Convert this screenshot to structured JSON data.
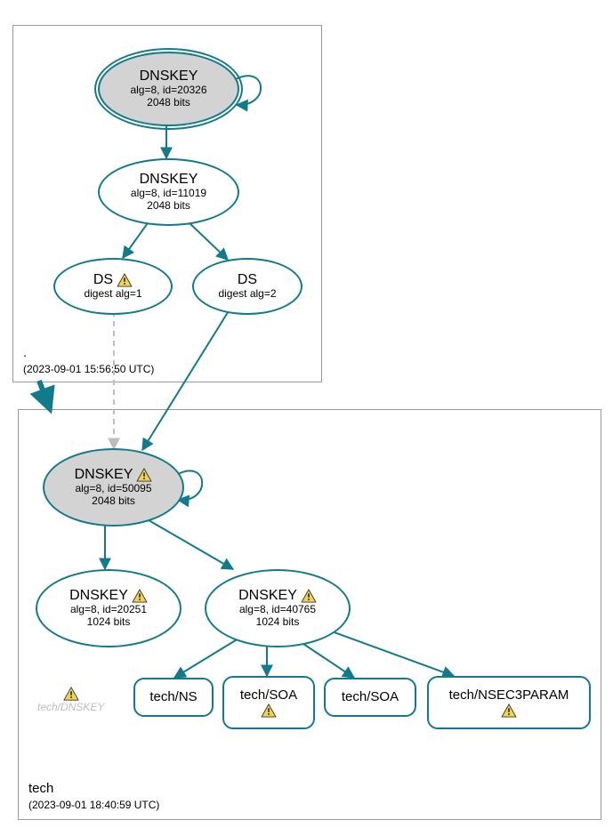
{
  "zones": {
    "root": {
      "name": ".",
      "timestamp": "(2023-09-01 15:56:50 UTC)"
    },
    "tech": {
      "name": "tech",
      "timestamp": "(2023-09-01 18:40:59 UTC)"
    }
  },
  "nodes": {
    "root_ksk": {
      "title": "DNSKEY",
      "sub1": "alg=8, id=20326",
      "sub2": "2048 bits"
    },
    "root_zsk": {
      "title": "DNSKEY",
      "sub1": "alg=8, id=11019",
      "sub2": "2048 bits"
    },
    "ds1": {
      "title": "DS",
      "sub1": "digest alg=1"
    },
    "ds2": {
      "title": "DS",
      "sub1": "digest alg=2"
    },
    "tech_ksk": {
      "title": "DNSKEY",
      "sub1": "alg=8, id=50095",
      "sub2": "2048 bits"
    },
    "tech_zsk1": {
      "title": "DNSKEY",
      "sub1": "alg=8, id=20251",
      "sub2": "1024 bits"
    },
    "tech_zsk2": {
      "title": "DNSKEY",
      "sub1": "alg=8, id=40765",
      "sub2": "1024 bits"
    },
    "rr_ns": {
      "title": "tech/NS"
    },
    "rr_soa_w": {
      "title": "tech/SOA"
    },
    "rr_soa": {
      "title": "tech/SOA"
    },
    "rr_nsec3": {
      "title": "tech/NSEC3PARAM"
    }
  },
  "floating": {
    "tech_dnskey": "tech/DNSKEY"
  },
  "colors": {
    "stroke": "#117a8b",
    "fill_grey": "#d3d3d3",
    "dashed": "#bdbdbd",
    "warn_fill": "#f4d24a",
    "warn_stroke": "#333"
  },
  "chart_data": {
    "type": "graph",
    "description": "DNSSEC authentication chain / DNSViz-style delegation graph from the root zone (.) to the 'tech' TLD, showing DNSKEY, DS, and signed RRsets with warning annotations.",
    "zones": [
      {
        "id": "root",
        "label": ".",
        "timestamp": "2023-09-01 15:56:50 UTC"
      },
      {
        "id": "tech",
        "label": "tech",
        "timestamp": "2023-09-01 18:40:59 UTC"
      }
    ],
    "nodes": [
      {
        "id": "root_ksk",
        "zone": "root",
        "type": "DNSKEY",
        "algorithm": 8,
        "key_id": 20326,
        "key_bits": 2048,
        "ksk": true,
        "trust_anchor": true,
        "warning": false
      },
      {
        "id": "root_zsk",
        "zone": "root",
        "type": "DNSKEY",
        "algorithm": 8,
        "key_id": 11019,
        "key_bits": 2048,
        "ksk": false,
        "warning": false
      },
      {
        "id": "ds1",
        "zone": "root",
        "type": "DS",
        "digest_algorithm": 1,
        "warning": true
      },
      {
        "id": "ds2",
        "zone": "root",
        "type": "DS",
        "digest_algorithm": 2,
        "warning": false
      },
      {
        "id": "tech_ksk",
        "zone": "tech",
        "type": "DNSKEY",
        "algorithm": 8,
        "key_id": 50095,
        "key_bits": 2048,
        "ksk": true,
        "warning": true
      },
      {
        "id": "tech_zsk1",
        "zone": "tech",
        "type": "DNSKEY",
        "algorithm": 8,
        "key_id": 20251,
        "key_bits": 1024,
        "ksk": false,
        "warning": true
      },
      {
        "id": "tech_zsk2",
        "zone": "tech",
        "type": "DNSKEY",
        "algorithm": 8,
        "key_id": 40765,
        "key_bits": 1024,
        "ksk": false,
        "warning": true
      },
      {
        "id": "rr_ns",
        "zone": "tech",
        "type": "RRset",
        "name": "tech/NS",
        "warning": false
      },
      {
        "id": "rr_soa_w",
        "zone": "tech",
        "type": "RRset",
        "name": "tech/SOA",
        "warning": true
      },
      {
        "id": "rr_soa",
        "zone": "tech",
        "type": "RRset",
        "name": "tech/SOA",
        "warning": false
      },
      {
        "id": "rr_nsec3",
        "zone": "tech",
        "type": "RRset",
        "name": "tech/NSEC3PARAM",
        "warning": true
      },
      {
        "id": "tech_dnskey_warn",
        "zone": "tech",
        "type": "annotation",
        "name": "tech/DNSKEY",
        "warning": true
      }
    ],
    "edges": [
      {
        "from": "root_ksk",
        "to": "root_ksk",
        "kind": "self-sign",
        "style": "solid"
      },
      {
        "from": "root_ksk",
        "to": "root_zsk",
        "kind": "signs",
        "style": "solid"
      },
      {
        "from": "root_zsk",
        "to": "ds1",
        "kind": "signs",
        "style": "solid"
      },
      {
        "from": "root_zsk",
        "to": "ds2",
        "kind": "signs",
        "style": "solid"
      },
      {
        "from": "ds1",
        "to": "tech_ksk",
        "kind": "delegation",
        "style": "dashed"
      },
      {
        "from": "ds2",
        "to": "tech_ksk",
        "kind": "delegation",
        "style": "solid"
      },
      {
        "from": "root",
        "to": "tech",
        "kind": "zone-delegation",
        "style": "solid-thick"
      },
      {
        "from": "tech_ksk",
        "to": "tech_ksk",
        "kind": "self-sign",
        "style": "solid"
      },
      {
        "from": "tech_ksk",
        "to": "tech_zsk1",
        "kind": "signs",
        "style": "solid"
      },
      {
        "from": "tech_ksk",
        "to": "tech_zsk2",
        "kind": "signs",
        "style": "solid"
      },
      {
        "from": "tech_zsk2",
        "to": "rr_ns",
        "kind": "signs",
        "style": "solid"
      },
      {
        "from": "tech_zsk2",
        "to": "rr_soa_w",
        "kind": "signs",
        "style": "solid"
      },
      {
        "from": "tech_zsk2",
        "to": "rr_soa",
        "kind": "signs",
        "style": "solid"
      },
      {
        "from": "tech_zsk2",
        "to": "rr_nsec3",
        "kind": "signs",
        "style": "solid"
      }
    ]
  }
}
